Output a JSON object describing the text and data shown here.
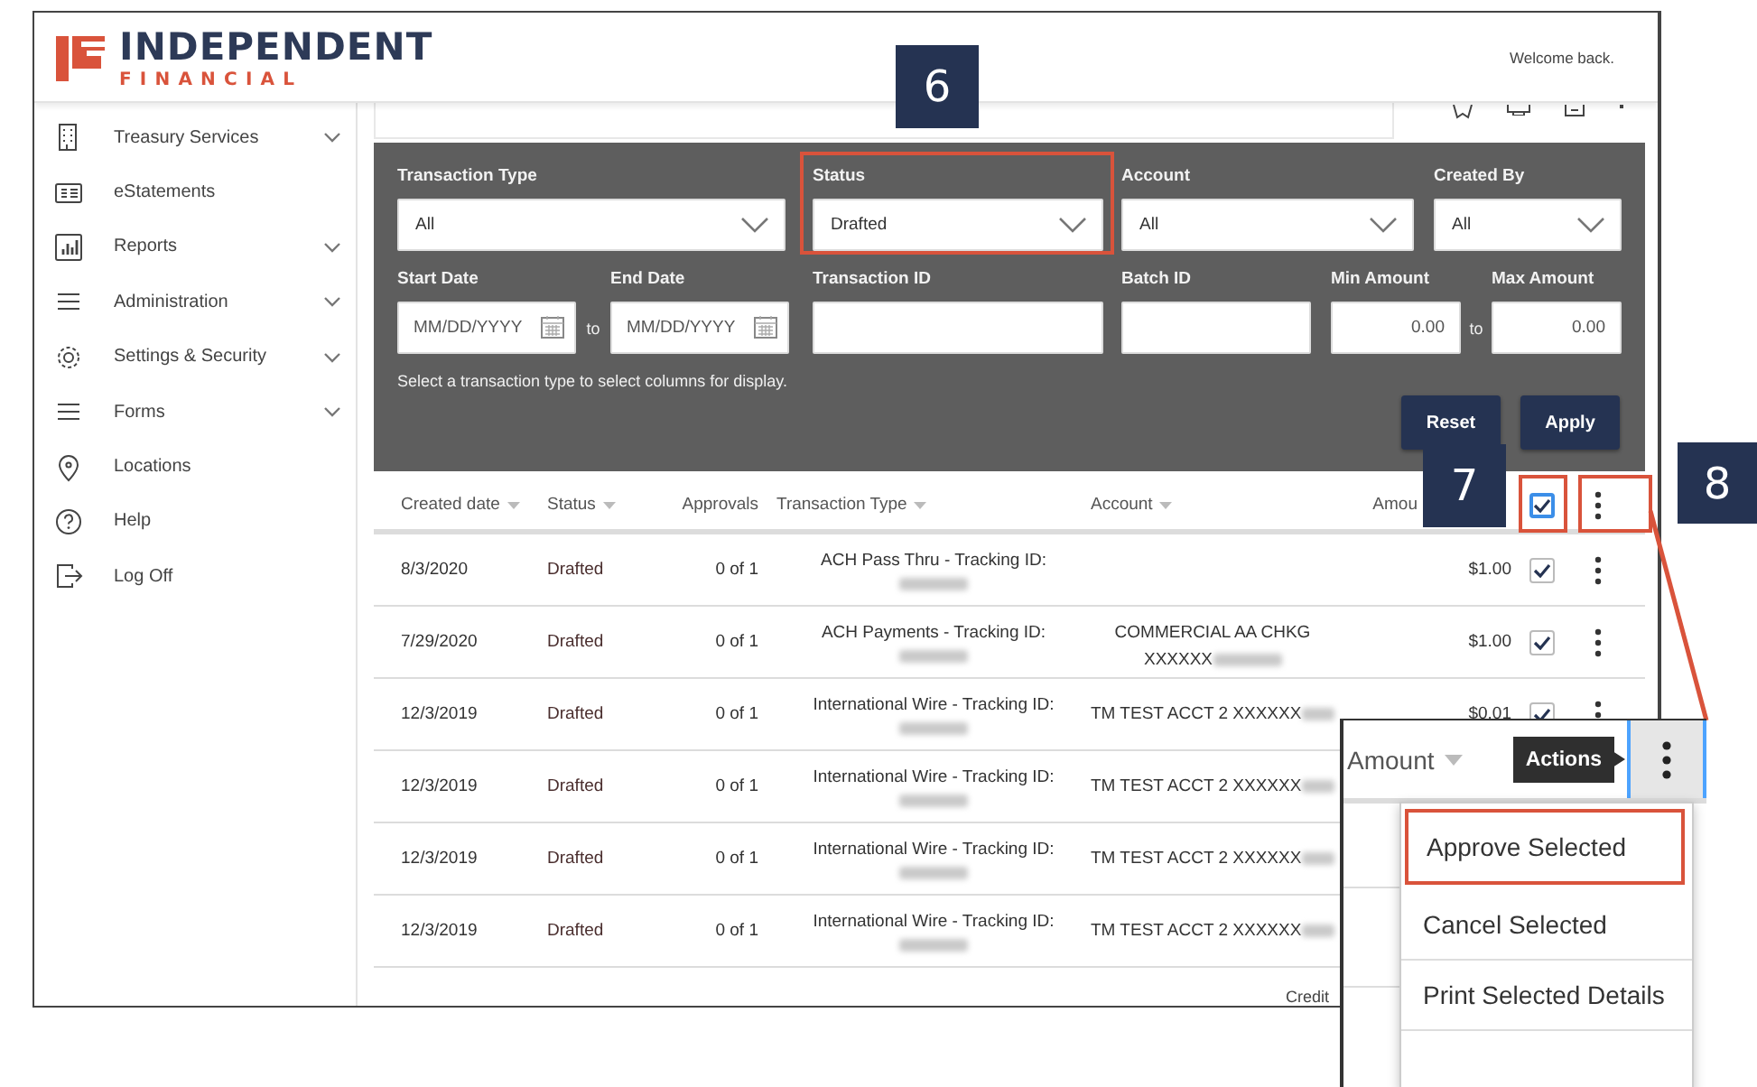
{
  "header": {
    "brand_top": "INDEPENDENT",
    "brand_bottom": "FINANCIAL",
    "welcome": "Welcome back."
  },
  "sidebar": {
    "items": [
      {
        "label": "Treasury Services",
        "expandable": true
      },
      {
        "label": "eStatements",
        "expandable": false
      },
      {
        "label": "Reports",
        "expandable": true
      },
      {
        "label": "Administration",
        "expandable": true
      },
      {
        "label": "Settings & Security",
        "expandable": true
      },
      {
        "label": "Forms",
        "expandable": true
      },
      {
        "label": "Locations",
        "expandable": false
      },
      {
        "label": "Help",
        "expandable": false
      },
      {
        "label": "Log Off",
        "expandable": false
      }
    ]
  },
  "filters": {
    "fields": [
      {
        "kind": "select",
        "label": "Transaction Type",
        "value": "All",
        "highlighted": false
      },
      {
        "kind": "select",
        "label": "Status",
        "value": "Drafted",
        "highlighted": true
      },
      {
        "kind": "select",
        "label": "Account",
        "value": "All",
        "highlighted": false
      },
      {
        "kind": "select",
        "label": "Created By",
        "value": "All",
        "highlighted": false
      },
      {
        "kind": "date",
        "label": "Start Date",
        "placeholder": "MM/DD/YYYY"
      },
      {
        "kind": "separator",
        "text": "to"
      },
      {
        "kind": "date",
        "label": "End Date",
        "placeholder": "MM/DD/YYYY"
      },
      {
        "kind": "text",
        "label": "Transaction ID"
      },
      {
        "kind": "text",
        "label": "Batch ID"
      },
      {
        "kind": "amount",
        "label": "Min Amount",
        "placeholder": "0.00"
      },
      {
        "kind": "separator",
        "text": "to"
      },
      {
        "kind": "amount",
        "label": "Max Amount",
        "placeholder": "0.00"
      }
    ],
    "hint": "Select a transaction type to select columns for display.",
    "buttons": [
      "Reset",
      "Apply"
    ]
  },
  "table": {
    "columns": [
      {
        "label": "Created date",
        "sortable": true
      },
      {
        "label": "Status",
        "sortable": true
      },
      {
        "label": "Approvals",
        "sortable": false
      },
      {
        "label": "Transaction Type",
        "sortable": true
      },
      {
        "label": "Account",
        "sortable": true
      },
      {
        "label": "Amou",
        "sortable": false
      }
    ],
    "select_all": {
      "checked": true,
      "highlighted": true
    },
    "actions": {
      "highlighted": true
    },
    "rows": [
      {
        "created": "8/3/2020",
        "status": "Drafted",
        "approvals": "0 of 1",
        "type": "ACH Pass Thru - Tracking ID:",
        "amount": "$1.00",
        "checked": true
      },
      {
        "created": "7/29/2020",
        "status": "Drafted",
        "approvals": "0 of 1",
        "type": "ACH Payments - Tracking ID:",
        "account": "COMMERCIAL AA CHKG",
        "account_2": "XXXXXX",
        "amount": "$1.00",
        "checked": true
      },
      {
        "created": "12/3/2019",
        "status": "Drafted",
        "approvals": "0 of 1",
        "type": "International Wire - Tracking ID:",
        "account": "TM TEST ACCT 2 XXXXXX",
        "amount": "$0.01",
        "checked": true
      },
      {
        "created": "12/3/2019",
        "status": "Drafted",
        "approvals": "0 of 1",
        "type": "International Wire - Tracking ID:",
        "account": "TM TEST ACCT 2 XXXXXX"
      },
      {
        "created": "12/3/2019",
        "status": "Drafted",
        "approvals": "0 of 1",
        "type": "International Wire - Tracking ID:",
        "account": "TM TEST ACCT 2 XXXXXX"
      },
      {
        "created": "12/3/2019",
        "status": "Drafted",
        "approvals": "0 of 1",
        "type": "International Wire - Tracking ID:",
        "account": "TM TEST ACCT 2 XXXXXX"
      }
    ],
    "footer": "Credit"
  },
  "inset": {
    "column": "Amount",
    "tooltip": "Actions",
    "menu": [
      {
        "label": "Approve Selected",
        "highlighted": true
      },
      {
        "label": "Cancel Selected",
        "highlighted": false
      },
      {
        "label": "Print Selected Details",
        "highlighted": false
      }
    ]
  },
  "callouts": [
    {
      "number": "6"
    },
    {
      "number": "7"
    },
    {
      "number": "8"
    }
  ]
}
